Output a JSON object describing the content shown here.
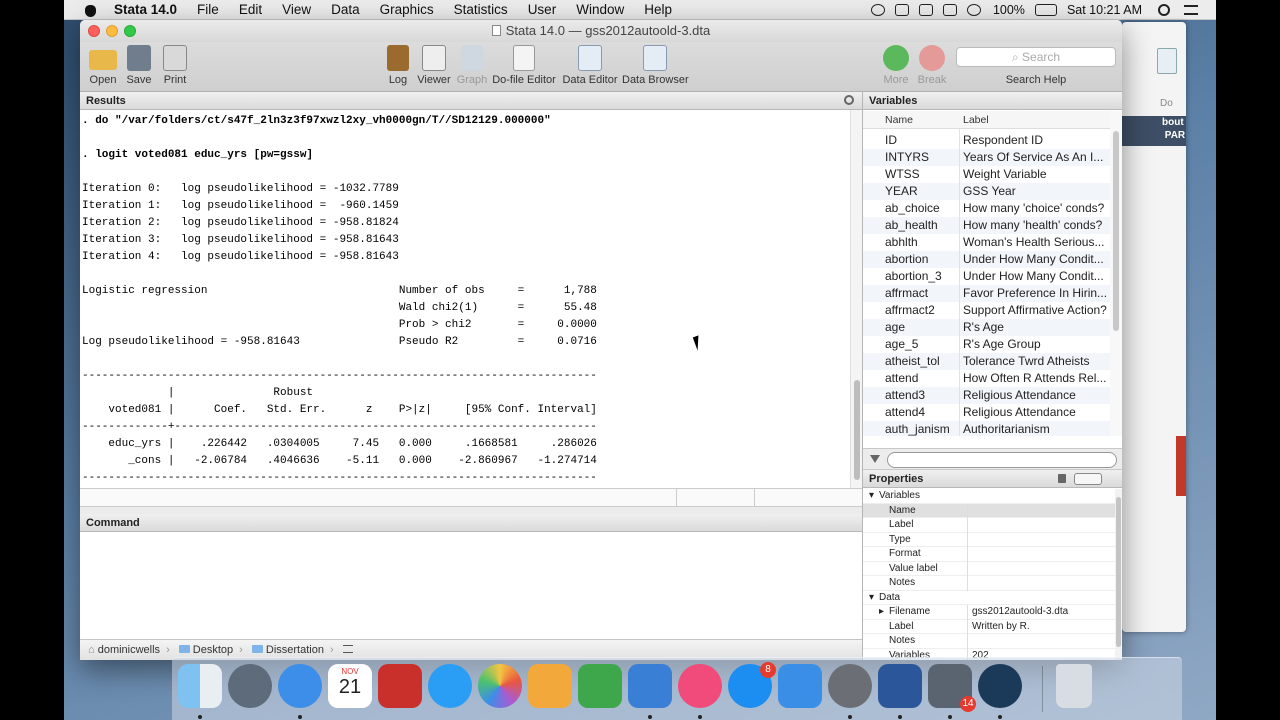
{
  "menubar": {
    "items": [
      "Stata 14.0",
      "File",
      "Edit",
      "View",
      "Data",
      "Graphics",
      "Statistics",
      "User",
      "Window",
      "Help"
    ],
    "battery": "100%",
    "clock": "Sat 10:21 AM"
  },
  "window": {
    "title": "Stata 14.0 — gss2012autoold-3.dta"
  },
  "toolbar": {
    "open": "Open",
    "save": "Save",
    "print": "Print",
    "log": "Log",
    "viewer": "Viewer",
    "graph": "Graph",
    "dofile_editor": "Do-file Editor",
    "data_editor": "Data Editor",
    "data_browser": "Data Browser",
    "more": "More",
    "break": "Break",
    "search_placeholder": "Search",
    "search_help": "Search Help"
  },
  "results": {
    "header": "Results",
    "lines": [
      ". do \"/var/folders/ct/s47f_2ln3z3f97xwzl2xy_vh0000gn/T//SD12129.000000\"",
      "",
      ". logit voted081 educ_yrs [pw=gssw]",
      "",
      "Iteration 0:   log pseudolikelihood = -1032.7789",
      "Iteration 1:   log pseudolikelihood =  -960.1459",
      "Iteration 2:   log pseudolikelihood = -958.81824",
      "Iteration 3:   log pseudolikelihood = -958.81643",
      "Iteration 4:   log pseudolikelihood = -958.81643",
      "",
      "Logistic regression                             Number of obs     =      1,788",
      "                                                Wald chi2(1)      =      55.48",
      "                                                Prob > chi2       =     0.0000",
      "Log pseudolikelihood = -958.81643               Pseudo R2         =     0.0716",
      "",
      "------------------------------------------------------------------------------",
      "             |               Robust",
      "    voted081 |      Coef.   Std. Err.      z    P>|z|     [95% Conf. Interval]",
      "-------------+----------------------------------------------------------------",
      "    educ_yrs |    .226442   .0304005     7.45   0.000     .1668581     .286026",
      "       _cons |   -2.06784   .4046636    -5.11   0.000    -2.860967   -1.274714",
      "------------------------------------------------------------------------------"
    ]
  },
  "command": {
    "header": "Command"
  },
  "pathbar": {
    "crumbs": [
      "dominicwells",
      "Desktop",
      "Dissertation"
    ]
  },
  "variables": {
    "header": "Variables",
    "col_name": "Name",
    "col_label": "Label",
    "rows": [
      {
        "name": "ID",
        "label": "Respondent ID"
      },
      {
        "name": "INTYRS",
        "label": "Years Of Service As An I..."
      },
      {
        "name": "WTSS",
        "label": "Weight Variable"
      },
      {
        "name": "YEAR",
        "label": "GSS Year"
      },
      {
        "name": "ab_choice",
        "label": "How many 'choice' conds?"
      },
      {
        "name": "ab_health",
        "label": "How many 'health' conds?"
      },
      {
        "name": "abhlth",
        "label": "Woman's Health Serious..."
      },
      {
        "name": "abortion",
        "label": "Under How Many Condit..."
      },
      {
        "name": "abortion_3",
        "label": "Under How Many Condit..."
      },
      {
        "name": "affrmact",
        "label": "Favor Preference In Hirin..."
      },
      {
        "name": "affrmact2",
        "label": "Support Affirmative Action?"
      },
      {
        "name": "age",
        "label": "R's Age"
      },
      {
        "name": "age_5",
        "label": "R's Age Group"
      },
      {
        "name": "atheist_tol",
        "label": "Tolerance Twrd Atheists"
      },
      {
        "name": "attend",
        "label": "How Often R Attends Rel..."
      },
      {
        "name": "attend3",
        "label": "Religious Attendance"
      },
      {
        "name": "attend4",
        "label": "Religious Attendance"
      },
      {
        "name": "auth_janism",
        "label": "Authoritarianism"
      }
    ]
  },
  "properties": {
    "header": "Properties",
    "variables_group": "Variables",
    "var_fields": [
      "Name",
      "Label",
      "Type",
      "Format",
      "Value label",
      "Notes"
    ],
    "data_group": "Data",
    "data_fields": [
      {
        "key": "Filename",
        "value": "gss2012autoold-3.dta"
      },
      {
        "key": "Label",
        "value": "Written by R."
      },
      {
        "key": "Notes",
        "value": ""
      },
      {
        "key": "Variables",
        "value": "202"
      }
    ]
  },
  "bgwindow": {
    "do_label": "Do",
    "side_text": "bout\n PAR"
  },
  "dock": {
    "calendar_month": "NOV",
    "calendar_day": "21",
    "appstore_badge": "8",
    "excel_badge": "14"
  }
}
